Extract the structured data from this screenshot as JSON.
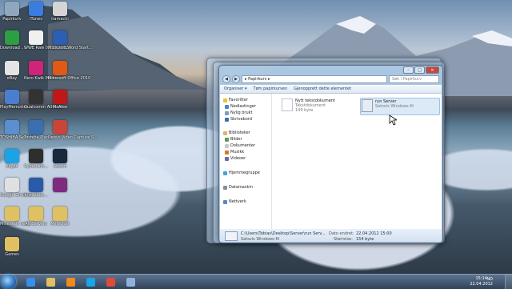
{
  "desktop_icons": [
    {
      "name": "papirkurv",
      "label": "Papirkurv",
      "icon": "recycle-bin-icon",
      "color": "#8fa7bf"
    },
    {
      "name": "itunes",
      "label": "iTunes",
      "icon": "itunes-icon",
      "color": "#3a7de0"
    },
    {
      "name": "hamachi",
      "label": "hamachi",
      "icon": "hamachi-icon",
      "color": "#d5d5d5"
    },
    {
      "name": "download",
      "label": "Download ...",
      "icon": "download-icon",
      "color": "#2c9f43"
    },
    {
      "name": "wwe-raw",
      "label": "WWE Raw 02.20.2012",
      "icon": "video-file-icon",
      "color": "#f0f0f0"
    },
    {
      "name": "word-starter",
      "label": "Microsoft Word Start...",
      "icon": "word-icon",
      "color": "#2b5fb3"
    },
    {
      "name": "ebay",
      "label": "eBay",
      "icon": "ebay-icon",
      "color": "#e4e4e4"
    },
    {
      "name": "nero-kwik",
      "label": "Nero Kwik Media",
      "icon": "nero-icon",
      "color": "#d0237a"
    },
    {
      "name": "office-2010",
      "label": "Microsoft Office 2010",
      "icon": "office-icon",
      "color": "#e05a16"
    },
    {
      "name": "playmemories",
      "label": "PlayMemories",
      "icon": "playmemories-icon",
      "color": "#4a7fd0"
    },
    {
      "name": "qualcomm",
      "label": "Qualcomm Atheros",
      "icon": "qualcomm-icon",
      "color": "#333333"
    },
    {
      "name": "mcafee",
      "label": "McAfee",
      "icon": "mcafee-icon",
      "color": "#c01818"
    },
    {
      "name": "toshiba",
      "label": "TOSHIBA Service...",
      "icon": "toshiba-icon",
      "color": "#5c8fcf"
    },
    {
      "name": "toshiba-places",
      "label": "Toshiba Places",
      "icon": "toshiba-places-icon",
      "color": "#3c6fb0"
    },
    {
      "name": "debut-video",
      "label": "Debut Video Capture S...",
      "icon": "debut-icon",
      "color": "#c8453a"
    },
    {
      "name": "skype",
      "label": "Skype",
      "icon": "skype-icon",
      "color": "#1aa3e6"
    },
    {
      "name": "cyberlink",
      "label": "CyberLink...",
      "icon": "cyberlink-icon",
      "color": "#2e2e2e"
    },
    {
      "name": "steam",
      "label": "Steam",
      "icon": "steam-icon",
      "color": "#17293f"
    },
    {
      "name": "google-chrome",
      "label": "Google Chrome",
      "icon": "chrome-icon",
      "color": "#e0e0e0"
    },
    {
      "name": "in-codbox",
      "label": "In codbox...",
      "icon": "lightning-icon",
      "color": "#2a5aa8"
    },
    {
      "name": "winrar",
      "label": "",
      "icon": "winrar-icon",
      "color": "#7e2a7e"
    },
    {
      "name": "minecraft",
      "label": "Minecraft news",
      "icon": "folder-icon",
      "color": "#e0c060"
    },
    {
      "name": "ak-servers",
      "label": "AK Servers",
      "icon": "folder-icon",
      "color": "#e0c060"
    },
    {
      "name": "minecraft2",
      "label": "Minecraft",
      "icon": "folder-icon",
      "color": "#e0c060"
    },
    {
      "name": "games",
      "label": "Games",
      "icon": "folder-icon",
      "color": "#e0c060"
    }
  ],
  "explorer": {
    "back": "◀",
    "forward": "▶",
    "address": "▸ Papirkurv ▸",
    "search_placeholder": "Søk i Papirkurv",
    "toolbar": [
      "Organiser ▾",
      "Tøm papirkurven",
      "Gjenopprett dette elementet"
    ],
    "nav": {
      "favorites": "Favoritter",
      "downloads": "Nedlastinger",
      "recent": "Nylig brukt",
      "desktop": "Skrivebord",
      "libraries": "Biblioteker",
      "pictures": "Bilder",
      "documents": "Dokumenter",
      "music": "Musikk",
      "videos": "Videoer",
      "homegroup": "Hjemmegruppe",
      "computer": "Datamaskin",
      "network": "Nettverk"
    },
    "files": [
      {
        "name": "Nytt tekstdokument",
        "type": "Tekstdokument",
        "size": "149 byte"
      },
      {
        "name": "run Server",
        "type": "Satsvis Windows-fil",
        "size": ""
      }
    ],
    "details": {
      "path": "C:\\Users\\Tobias\\Desktop\\Server\\run Serv...",
      "type": "Satsvis Windows-fil",
      "date_label": "Dato endret:",
      "date": "22.04.2012 15:00",
      "size_label": "Størrelse:",
      "size": "154 byte"
    },
    "window_controls": {
      "minimize": "–",
      "maximize": "□",
      "close": "✕"
    }
  },
  "taskbar": {
    "items": [
      {
        "name": "ie",
        "icon": "internet-explorer-icon",
        "color": "#3a8ee6"
      },
      {
        "name": "explorer",
        "icon": "folder-icon",
        "color": "#e0c060"
      },
      {
        "name": "media-player",
        "icon": "media-player-icon",
        "color": "#f08a1a"
      },
      {
        "name": "skype",
        "icon": "skype-icon",
        "color": "#1aa3e6"
      },
      {
        "name": "chrome",
        "icon": "chrome-icon",
        "color": "#e04a3a"
      },
      {
        "name": "save",
        "icon": "save-icon",
        "color": "#8fb0d8"
      }
    ],
    "tray_lang": "NO",
    "time": "15:14",
    "date": "22.04.2012"
  }
}
